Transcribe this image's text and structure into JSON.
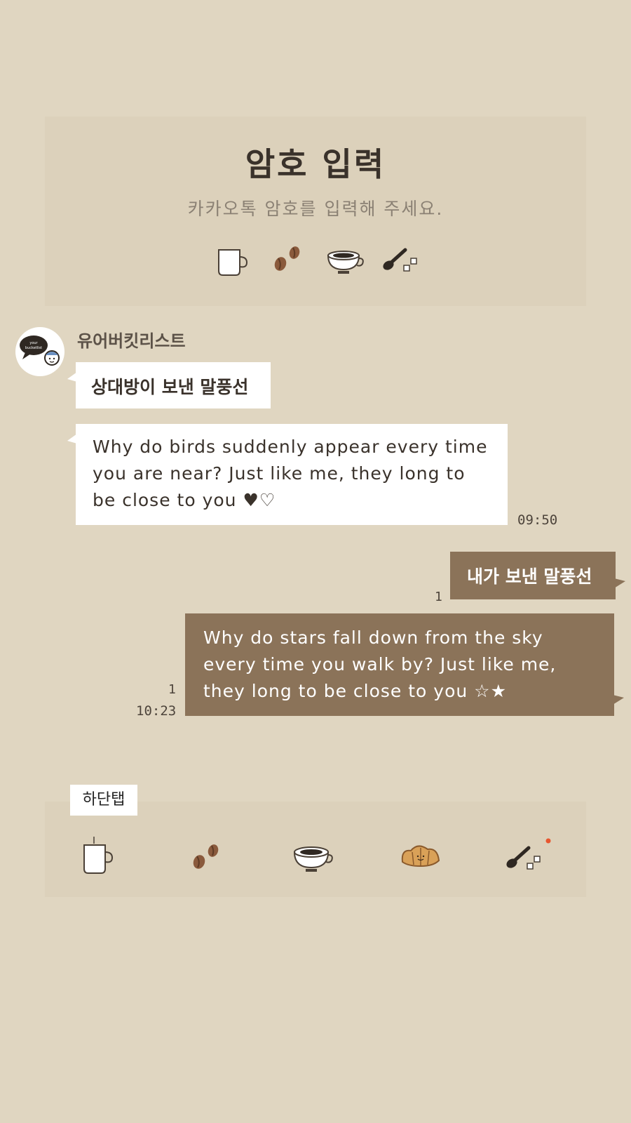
{
  "lock_screen": {
    "title": "암호 입력",
    "subtitle": "카카오톡 암호를 입력해 주세요.",
    "pin_icons": [
      "mug-icon",
      "coffee-beans-icon",
      "coffee-cup-icon",
      "spoon-sugar-icon"
    ]
  },
  "chat": {
    "sender_name": "유어버킷리스트",
    "avatar_icon": "yourbucketlist-avatar-icon",
    "messages": [
      {
        "side": "received",
        "text": "상대방이 보낸 말풍선"
      },
      {
        "side": "received",
        "text": "Why do birds suddenly appear every time you are near? Just like me, they long to be close to you ♥♡",
        "time": "09:50"
      },
      {
        "side": "sent",
        "text": "내가 보낸 말풍선",
        "read_count": "1"
      },
      {
        "side": "sent",
        "text": "Why do stars fall down from the sky every time you walk by? Just like me, they long to be close to you ☆★",
        "read_count": "1",
        "time": "10:23"
      }
    ]
  },
  "tabbar": {
    "label": "하단탭",
    "tabs": [
      "mug-icon",
      "coffee-beans-icon",
      "coffee-cup-icon",
      "croissant-icon",
      "spoon-sugar-icon"
    ],
    "badge_color": "#e8562f"
  },
  "colors": {
    "background": "#e0d6c1",
    "panel": "#dcd1bb",
    "sent_bubble": "#8b7359",
    "received_bubble": "#ffffff",
    "text_dark": "#3a322b"
  }
}
